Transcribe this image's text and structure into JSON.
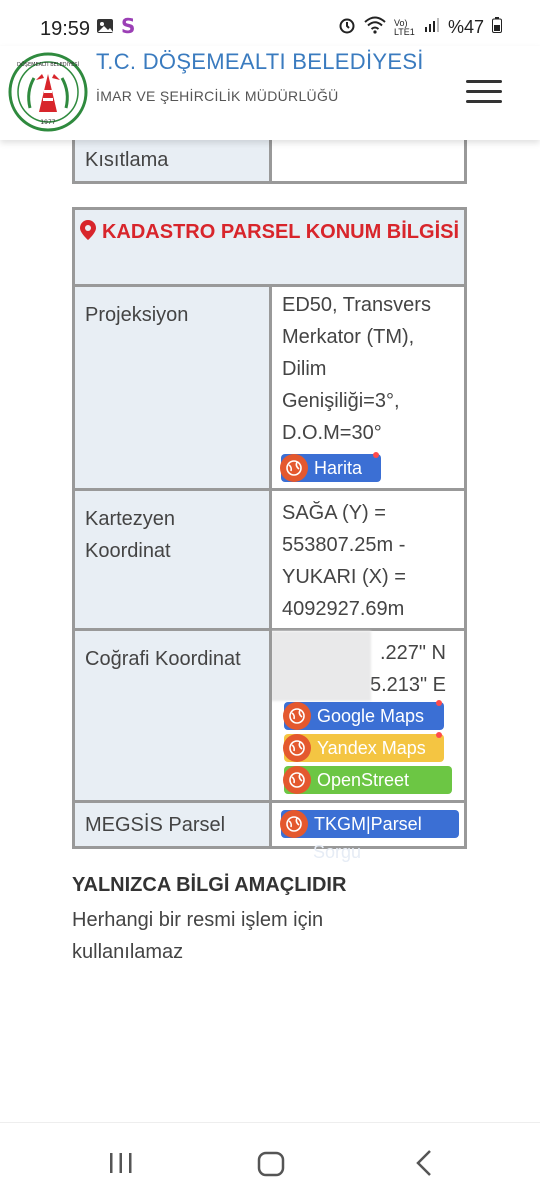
{
  "status_bar": {
    "time": "19:59",
    "battery": "%47",
    "network": "Vo) LTE1",
    "icons": [
      "image-icon",
      "s-app-icon",
      "alarm-icon",
      "wifi-icon",
      "signal-icon",
      "battery-icon"
    ]
  },
  "header": {
    "title": "T.C. DÖŞEMEALTI BELEDİYESİ",
    "subtitle": "İMAR VE ŞEHİRCİLİK MÜDÜRLÜĞÜ",
    "logo_text": "DÖŞEMEALTI BELEDİYESİ",
    "logo_year": "1977",
    "title_color": "#3a7bbf"
  },
  "top_partial_row": {
    "label": "Kısıtlama",
    "value": ""
  },
  "cadastre": {
    "title": "KADASTRO PARSEL KONUM BİLGİSİ",
    "title_color": "#d8252b",
    "rows": [
      {
        "label": "Projeksiyon",
        "value_lines": [
          "ED50, Transvers",
          "Merkator (TM),",
          "Dilim",
          "Genişiliği=3°,",
          "D.O.M=30°"
        ]
      },
      {
        "label_lines": [
          "Kartezyen",
          "Koordinat"
        ],
        "value_lines": [
          "SAĞA (Y) =",
          "553807.25m -",
          "YUKARI (X) =",
          "4092927.69m"
        ]
      },
      {
        "label": "Coğrafi Koordinat",
        "value_lines": [
          ".227\" N",
          "5.213\" E"
        ]
      },
      {
        "label": "MEGSİS Parsel"
      }
    ],
    "buttons": {
      "harita": "Harita",
      "google": "Google Maps",
      "yandex": "Yandex Maps",
      "osm": "OpenStreet",
      "tkgm": "TKGM|Parsel",
      "tkgm_overflow": "Sorgu"
    },
    "button_colors": {
      "harita": "#3b6fd4",
      "google": "#3b6fd4",
      "yandex": "#f4c542",
      "osm": "#6cc644",
      "tkgm": "#3b6fd4",
      "globe": "#e4582e"
    }
  },
  "note": {
    "title": "YALNIZCA BİLGİ AMAÇLIDIR",
    "text": "Herhangi bir resmi işlem için kullanılamaz"
  },
  "nav": {
    "icons": [
      "recent-apps-icon",
      "home-icon",
      "back-icon"
    ]
  }
}
